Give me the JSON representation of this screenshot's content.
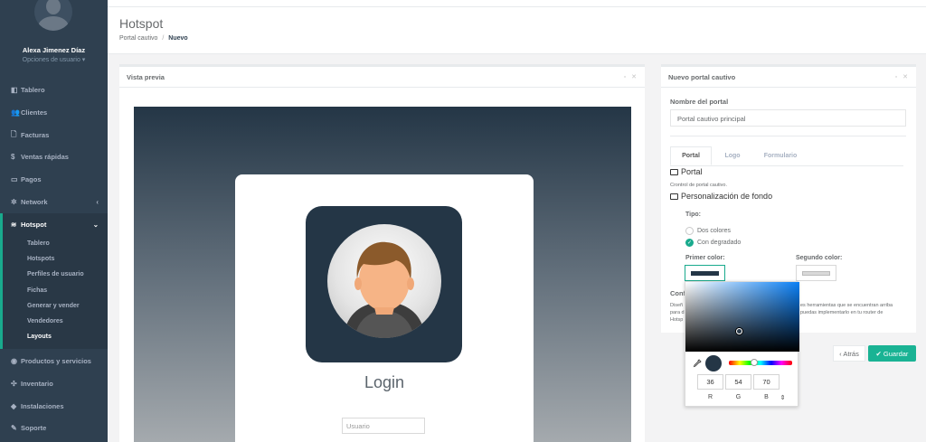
{
  "sidebar": {
    "user_name": "Alexa Jimenez Díaz",
    "user_options": "Opciones de usuario ▾",
    "items": [
      {
        "icon": "dashboard-icon",
        "glyph": "◧",
        "label": "Tablero"
      },
      {
        "icon": "users-icon",
        "glyph": "👥",
        "label": "Clientes"
      },
      {
        "icon": "file-icon",
        "glyph": "🗋",
        "label": "Facturas"
      },
      {
        "icon": "dollar-icon",
        "glyph": "$",
        "label": "Ventas rápidas"
      },
      {
        "icon": "money-icon",
        "glyph": "▭",
        "label": "Pagos"
      },
      {
        "icon": "network-icon",
        "glyph": "✲",
        "label": "Network",
        "arrow": "‹"
      }
    ],
    "hotspot": {
      "glyph": "≋",
      "label": "Hotspot",
      "arrow": "⌄",
      "sub_items": [
        "Tablero",
        "Hotspots",
        "Perfiles de usuario",
        "Fichas",
        "Generar y vender",
        "Vendedores",
        "Layouts"
      ]
    },
    "bottom_items": [
      {
        "icon": "boxes-icon",
        "glyph": "◉",
        "label": "Productos y servicios"
      },
      {
        "icon": "inventory-icon",
        "glyph": "✣",
        "label": "Inventario"
      },
      {
        "icon": "installations-icon",
        "glyph": "◆",
        "label": "Instalaciones"
      },
      {
        "icon": "wrench-icon",
        "glyph": "✎",
        "label": "Soporte"
      }
    ]
  },
  "header": {
    "title": "Hotspot",
    "breadcrumb_parent": "Portal cautivo",
    "breadcrumb_sep": "/",
    "breadcrumb_current": "Nuevo"
  },
  "preview": {
    "title": "Vista previa",
    "tools": "▫ ✕",
    "login_title": "Login",
    "username_placeholder": "Usuario"
  },
  "form": {
    "title": "Nuevo portal cautivo",
    "tools": "▫ ✕",
    "name_label": "Nombre del portal",
    "name_value": "Portal cautivo principal",
    "tabs": [
      "Portal",
      "Logo",
      "Formulario"
    ],
    "section_portal": "Portal",
    "portal_help": "Crontrol de portal cautivo.",
    "section_background": "Personalización de fondo",
    "type_label": "Tipo:",
    "option_two_colors": "Dos colores",
    "option_gradient": "Con degradado",
    "first_color_label": "Primer color:",
    "second_color_label": "Segundo color:",
    "first_color": "#243646",
    "second_color": "#d9d9d9",
    "config_label_partial": "Conf",
    "hidden_text_line1_start": "Diseñ",
    "hidden_text_line1_end": "es herramientas que se encuentran arriba",
    "hidden_text_line2_start": "para d",
    "hidden_text_line2_end": "puedas implementarlo en tu router de",
    "hidden_text_line3_start": "Hotsp"
  },
  "buttons": {
    "back": "‹ Atrás",
    "save": "✔ Guardar"
  },
  "picker": {
    "r": "36",
    "g": "54",
    "b": "70",
    "r_label": "R",
    "g_label": "G",
    "b_label": "B",
    "mode_toggle": "⇕"
  }
}
